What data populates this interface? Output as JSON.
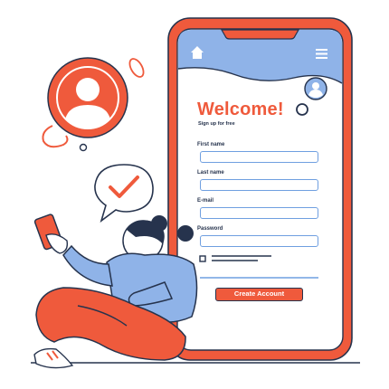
{
  "colors": {
    "accent": "#ef5a3c",
    "outline": "#26334d",
    "blue": "#8fb3e8",
    "field_border": "#6f9fe0"
  },
  "signup_form": {
    "title": "Welcome!",
    "subtitle": "Sign up for free",
    "fields": [
      {
        "label": "First name",
        "value": ""
      },
      {
        "label": "Last name",
        "value": ""
      },
      {
        "label": "E-mail",
        "value": ""
      },
      {
        "label": "Password",
        "value": ""
      }
    ],
    "create_button": "Create Account"
  },
  "icons": {
    "header_left": "home-icon",
    "header_right": "hamburger-menu-icon",
    "avatar": "user-avatar-icon",
    "bubble": "checkmark-icon",
    "profile": "user-profile-icon"
  }
}
